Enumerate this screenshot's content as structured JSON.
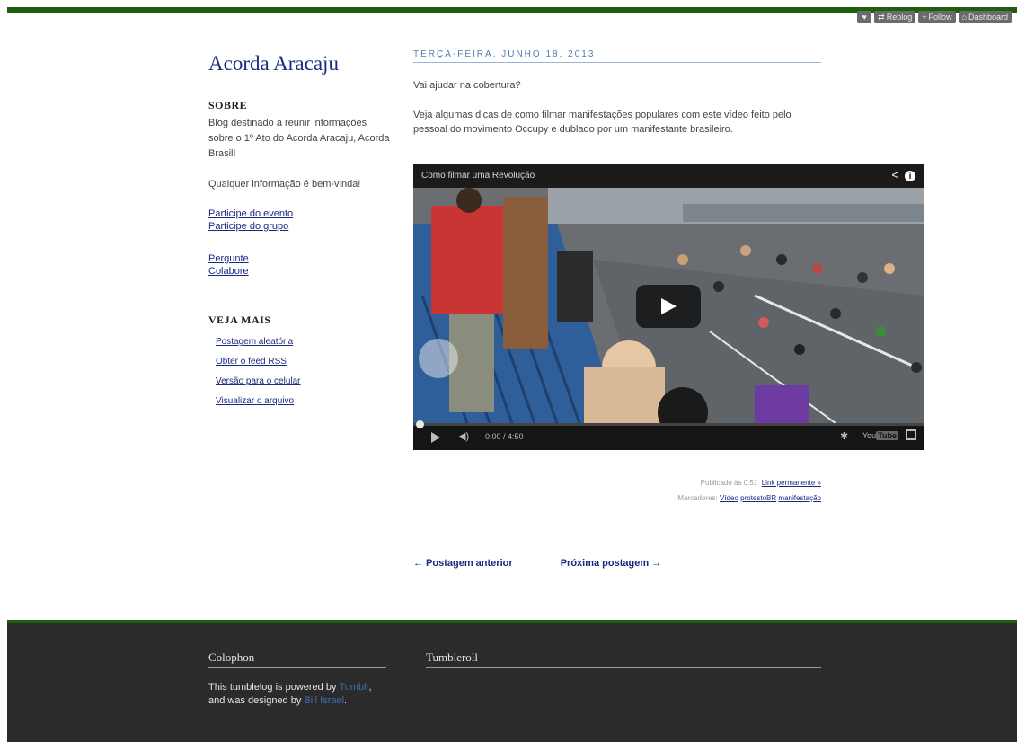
{
  "toolbar": {
    "reblog_label": "Reblog",
    "follow_label": "Follow",
    "dashboard_label": "Dashboard"
  },
  "sidebar": {
    "blog_title": "Acorda Aracaju",
    "sobre_heading": "SOBRE",
    "sobre_text": "Blog destinado a reunir informações sobre o 1º Ato do Acorda Aracaju, Acorda Brasil!",
    "info_text": "Qualquer informação é bem-vinda!",
    "links1": [
      "Participe do evento",
      "Participe do grupo"
    ],
    "links2": [
      "Pergunte",
      "Colabore"
    ],
    "veja_heading": "VEJA MAIS",
    "veja_items": [
      "Postagem aleatória",
      "Obter o feed RSS",
      "Versão para o celular",
      "Visualizar o arquivo"
    ]
  },
  "post": {
    "date": "TERÇA-FEIRA, JUNHO 18, 2013",
    "paragraph1": "Vai ajudar na cobertura?",
    "paragraph2": "Veja algumas dicas de como filmar manifestações populares com este vídeo feito pelo pessoal do movimento Occupy e dublado por um manifestante brasileiro.",
    "video": {
      "title": "Como filmar uma Revolução",
      "time": "0:00 / 4:50",
      "youtube_label": "You"
    },
    "meta": {
      "published_prefix": "Publicado às 0:51",
      "permalink_label": "Link permanente »",
      "tags_prefix": "Marcadores:",
      "tags": [
        "Vídeo",
        "protestoBR",
        "manifestação"
      ]
    },
    "nav": {
      "prev_label": "← Postagem anterior",
      "next_label": "Próxima postagem →"
    }
  },
  "footer": {
    "colophon_heading": "Colophon",
    "colophon_text_1": "This tumblelog is powered by",
    "tumblr_link": "Tumblr",
    "colophon_text_2": ", and was designed by",
    "designer_link": "Bill Israel",
    "colophon_end": ".",
    "tumbleroll_heading": "Tumbleroll"
  },
  "colors": {
    "accent_green": "#1d5e0f",
    "link_blue": "#1a2a80",
    "footer_bg": "#2b2b2b"
  }
}
